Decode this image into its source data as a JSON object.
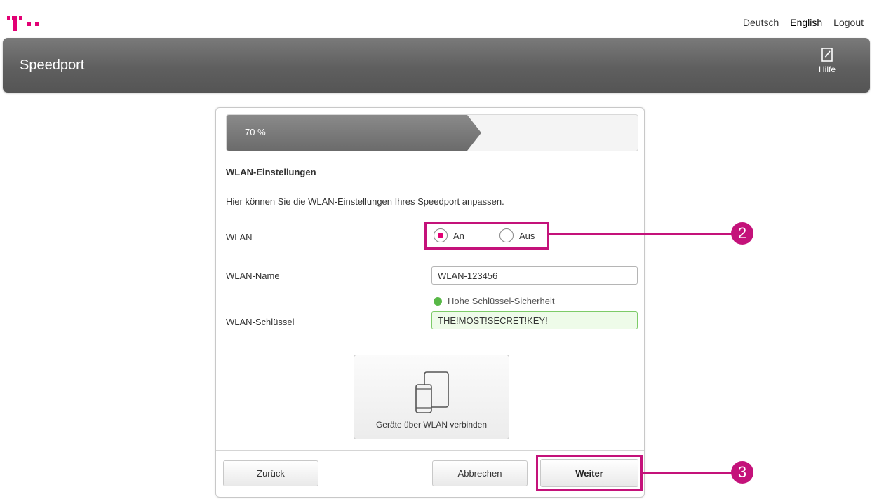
{
  "header": {
    "title": "Speedport",
    "help_label": "Hilfe",
    "links": [
      "Deutsch",
      "English",
      "Logout"
    ],
    "active_language": "English"
  },
  "progress": {
    "label": "70 %",
    "value": 0.7
  },
  "wlan_settings": {
    "title": "WLAN-Einstellungen",
    "intro": "Hier können Sie die WLAN-Einstellungen Ihres Speedport anpassen.",
    "wlan_label": "WLAN",
    "radio_on_label": "An",
    "radio_off_label": "Aus",
    "selected": "An",
    "name_label": "WLAN-Name",
    "name_value": "WLAN-123456",
    "key_label": "WLAN-Schlüssel",
    "key_value": "THE!MOST!SECRET!KEY!",
    "strength_text": "Hohe Schlüssel-Sicherheit",
    "wps_button_label": "Geräte über WLAN verbinden"
  },
  "buttons": {
    "back": "Zurück",
    "cancel": "Abbrechen",
    "next": "Weiter"
  },
  "callouts": {
    "radio": "2",
    "next": "3"
  },
  "colors": {
    "brand": "#e20074",
    "callout": "#c4127a",
    "header": "#666666",
    "success": "#58b847"
  }
}
